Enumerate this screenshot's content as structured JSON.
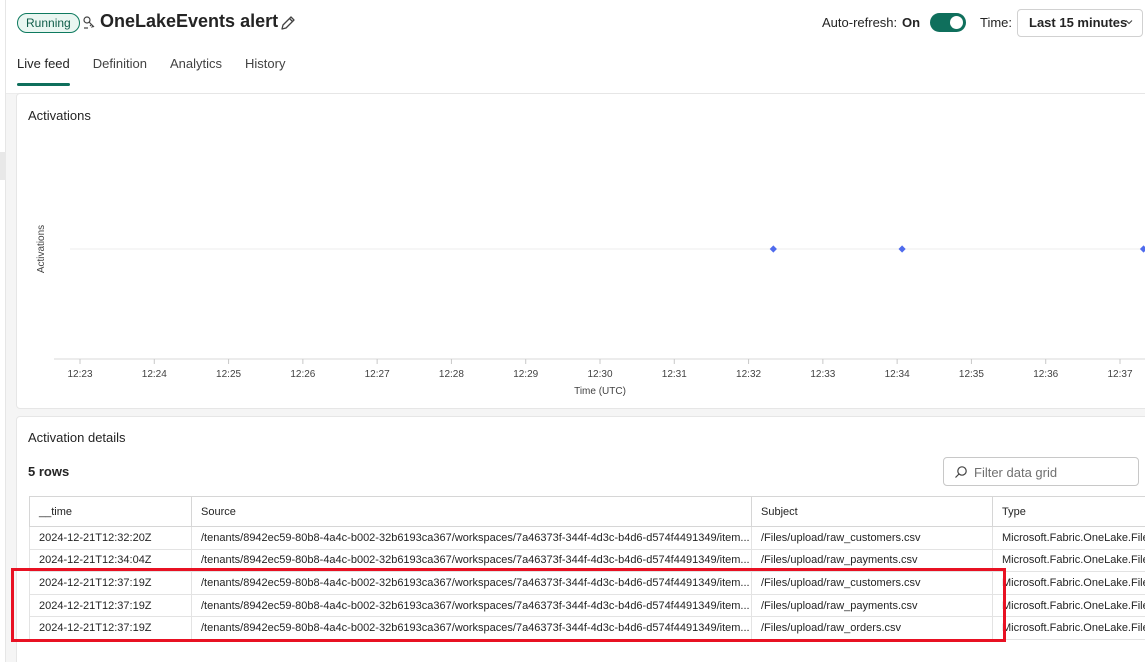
{
  "header": {
    "status": "Running",
    "title": "OneLakeEvents alert",
    "autorefresh_label": "Auto-refresh:",
    "autorefresh_value": "On",
    "time_label": "Time:",
    "time_value": "Last 15 minutes"
  },
  "tabs": [
    {
      "label": "Live feed",
      "active": true
    },
    {
      "label": "Definition"
    },
    {
      "label": "Analytics"
    },
    {
      "label": "History"
    }
  ],
  "icons": {
    "title": "alert-icon",
    "edit": "pencil-icon",
    "time_chevron": "chevron-down-icon",
    "filter": "search-icon"
  },
  "colors": {
    "accent": "#0f6f5c",
    "point": "#4f6bed",
    "highlight": "#e81123"
  },
  "activations": {
    "title": "Activations"
  },
  "chart_data": {
    "type": "scatter",
    "title": "Activations",
    "xlabel": "Time (UTC)",
    "ylabel": "Activations",
    "x_ticks": [
      "12:23",
      "12:24",
      "12:25",
      "12:26",
      "12:27",
      "12:28",
      "12:29",
      "12:30",
      "12:31",
      "12:32",
      "12:33",
      "12:34",
      "12:35",
      "12:36",
      "12:37"
    ],
    "points": [
      {
        "x": "12:32:20",
        "y": 1
      },
      {
        "x": "12:34:04",
        "y": 1
      },
      {
        "x": "12:37:19",
        "y": 1
      }
    ],
    "grid": "horizontal"
  },
  "details": {
    "title": "Activation details",
    "rows_count": "5 rows",
    "filter_placeholder": "Filter data grid",
    "columns": [
      "__time",
      "Source",
      "Subject",
      "Type"
    ],
    "rows": [
      [
        "2024-12-21T12:32:20Z",
        "/tenants/8942ec59-80b8-4a4c-b002-32b6193ca367/workspaces/7a46373f-344f-4d3c-b4d6-d574f4491349/item...",
        "/Files/upload/raw_customers.csv",
        "Microsoft.Fabric.OneLake.File"
      ],
      [
        "2024-12-21T12:34:04Z",
        "/tenants/8942ec59-80b8-4a4c-b002-32b6193ca367/workspaces/7a46373f-344f-4d3c-b4d6-d574f4491349/item...",
        "/Files/upload/raw_payments.csv",
        "Microsoft.Fabric.OneLake.File"
      ],
      [
        "2024-12-21T12:37:19Z",
        "/tenants/8942ec59-80b8-4a4c-b002-32b6193ca367/workspaces/7a46373f-344f-4d3c-b4d6-d574f4491349/item...",
        "/Files/upload/raw_customers.csv",
        "Microsoft.Fabric.OneLake.File"
      ],
      [
        "2024-12-21T12:37:19Z",
        "/tenants/8942ec59-80b8-4a4c-b002-32b6193ca367/workspaces/7a46373f-344f-4d3c-b4d6-d574f4491349/item...",
        "/Files/upload/raw_payments.csv",
        "Microsoft.Fabric.OneLake.File"
      ],
      [
        "2024-12-21T12:37:19Z",
        "/tenants/8942ec59-80b8-4a4c-b002-32b6193ca367/workspaces/7a46373f-344f-4d3c-b4d6-d574f4491349/item...",
        "/Files/upload/raw_orders.csv",
        "Microsoft.Fabric.OneLake.File"
      ]
    ]
  }
}
